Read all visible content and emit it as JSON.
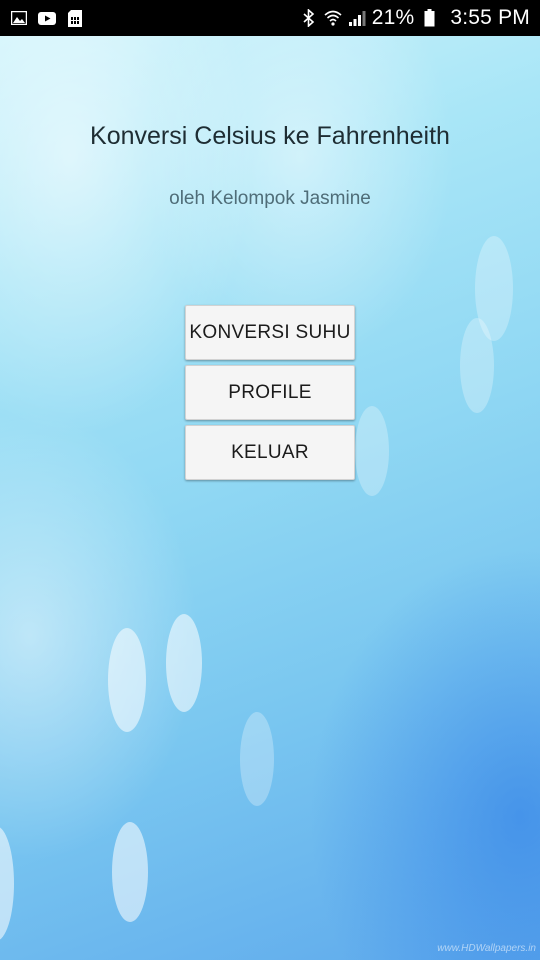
{
  "status_bar": {
    "battery_percent": "21%",
    "time": "3:55 PM",
    "left_icons": [
      "gallery-icon",
      "youtube-icon",
      "sim-card-icon"
    ],
    "right_icons": [
      "bluetooth-icon",
      "wifi-icon",
      "signal-icon",
      "battery-icon"
    ]
  },
  "main": {
    "title": "Konversi Celsius ke Fahrenheith",
    "subtitle": "oleh Kelompok Jasmine",
    "buttons": {
      "konversi": "KONVERSI SUHU",
      "profile": "PROFILE",
      "keluar": "KELUAR"
    }
  },
  "background": {
    "watermark": "www.HDWallpapers.in"
  },
  "colors": {
    "status_bar": "#000000",
    "button_bg": "#f5f5f5",
    "title_text": "#1e2d33",
    "subtitle_text": "#4f6d78"
  }
}
